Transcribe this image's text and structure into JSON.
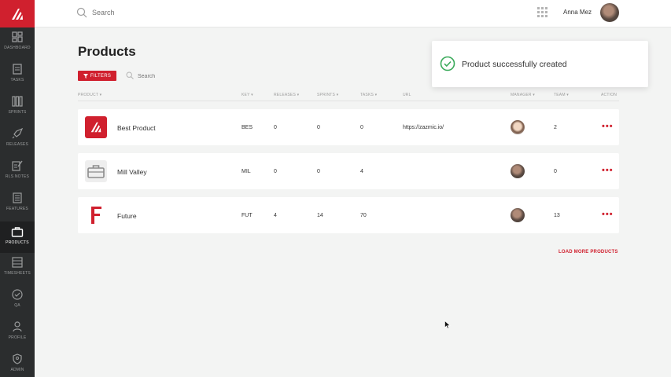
{
  "colors": {
    "brand": "#d0202e",
    "sidebar": "#2b2d2e",
    "background": "#f3f4f3",
    "success": "#3aaa5a"
  },
  "sidebar": {
    "items": [
      {
        "label": "DASHBOARD",
        "icon": "dashboard-icon"
      },
      {
        "label": "TASKS",
        "icon": "tasks-icon"
      },
      {
        "label": "SPRINTS",
        "icon": "sprints-icon"
      },
      {
        "label": "RELEASES",
        "icon": "rocket-icon"
      },
      {
        "label": "RLS NOTES",
        "icon": "notes-icon"
      },
      {
        "label": "FEATURES",
        "icon": "features-icon"
      },
      {
        "label": "PRODUCTS",
        "icon": "briefcase-icon",
        "active": true
      },
      {
        "label": "TIMESHEETS",
        "icon": "timesheets-icon"
      },
      {
        "label": "QA",
        "icon": "check-circle-icon"
      },
      {
        "label": "PROFILE",
        "icon": "user-icon"
      },
      {
        "label": "ADMIN",
        "icon": "shield-icon"
      }
    ]
  },
  "topbar": {
    "search_placeholder": "Search",
    "user_name": "Anna Mez"
  },
  "page": {
    "title": "Products"
  },
  "toolbar": {
    "filters_label": "FILTERS",
    "search_placeholder": "Search"
  },
  "table": {
    "columns": {
      "product": "PRODUCT ▾",
      "key": "KEY ▾",
      "releases": "RELEASES ▾",
      "sprints": "SPRINTS ▾",
      "tasks": "TASKS ▾",
      "url": "URL",
      "manager": "MANAGER ▾",
      "team": "TEAM ▾",
      "action": "ACTION"
    },
    "rows": [
      {
        "name": "Best Product",
        "key": "BES",
        "releases": "0",
        "sprints": "0",
        "tasks": "0",
        "url": "https://zazmic.io/",
        "team": "2",
        "action": "•••"
      },
      {
        "name": "Mill Valley",
        "key": "MIL",
        "releases": "0",
        "sprints": "0",
        "tasks": "4",
        "url": "",
        "team": "0",
        "action": "•••"
      },
      {
        "name": "Future",
        "key": "FUT",
        "releases": "4",
        "sprints": "14",
        "tasks": "70",
        "url": "",
        "team": "13",
        "action": "•••"
      }
    ]
  },
  "load_more_label": "LOAD MORE PRODUCTS",
  "toast": {
    "message": "Product successfully created"
  }
}
